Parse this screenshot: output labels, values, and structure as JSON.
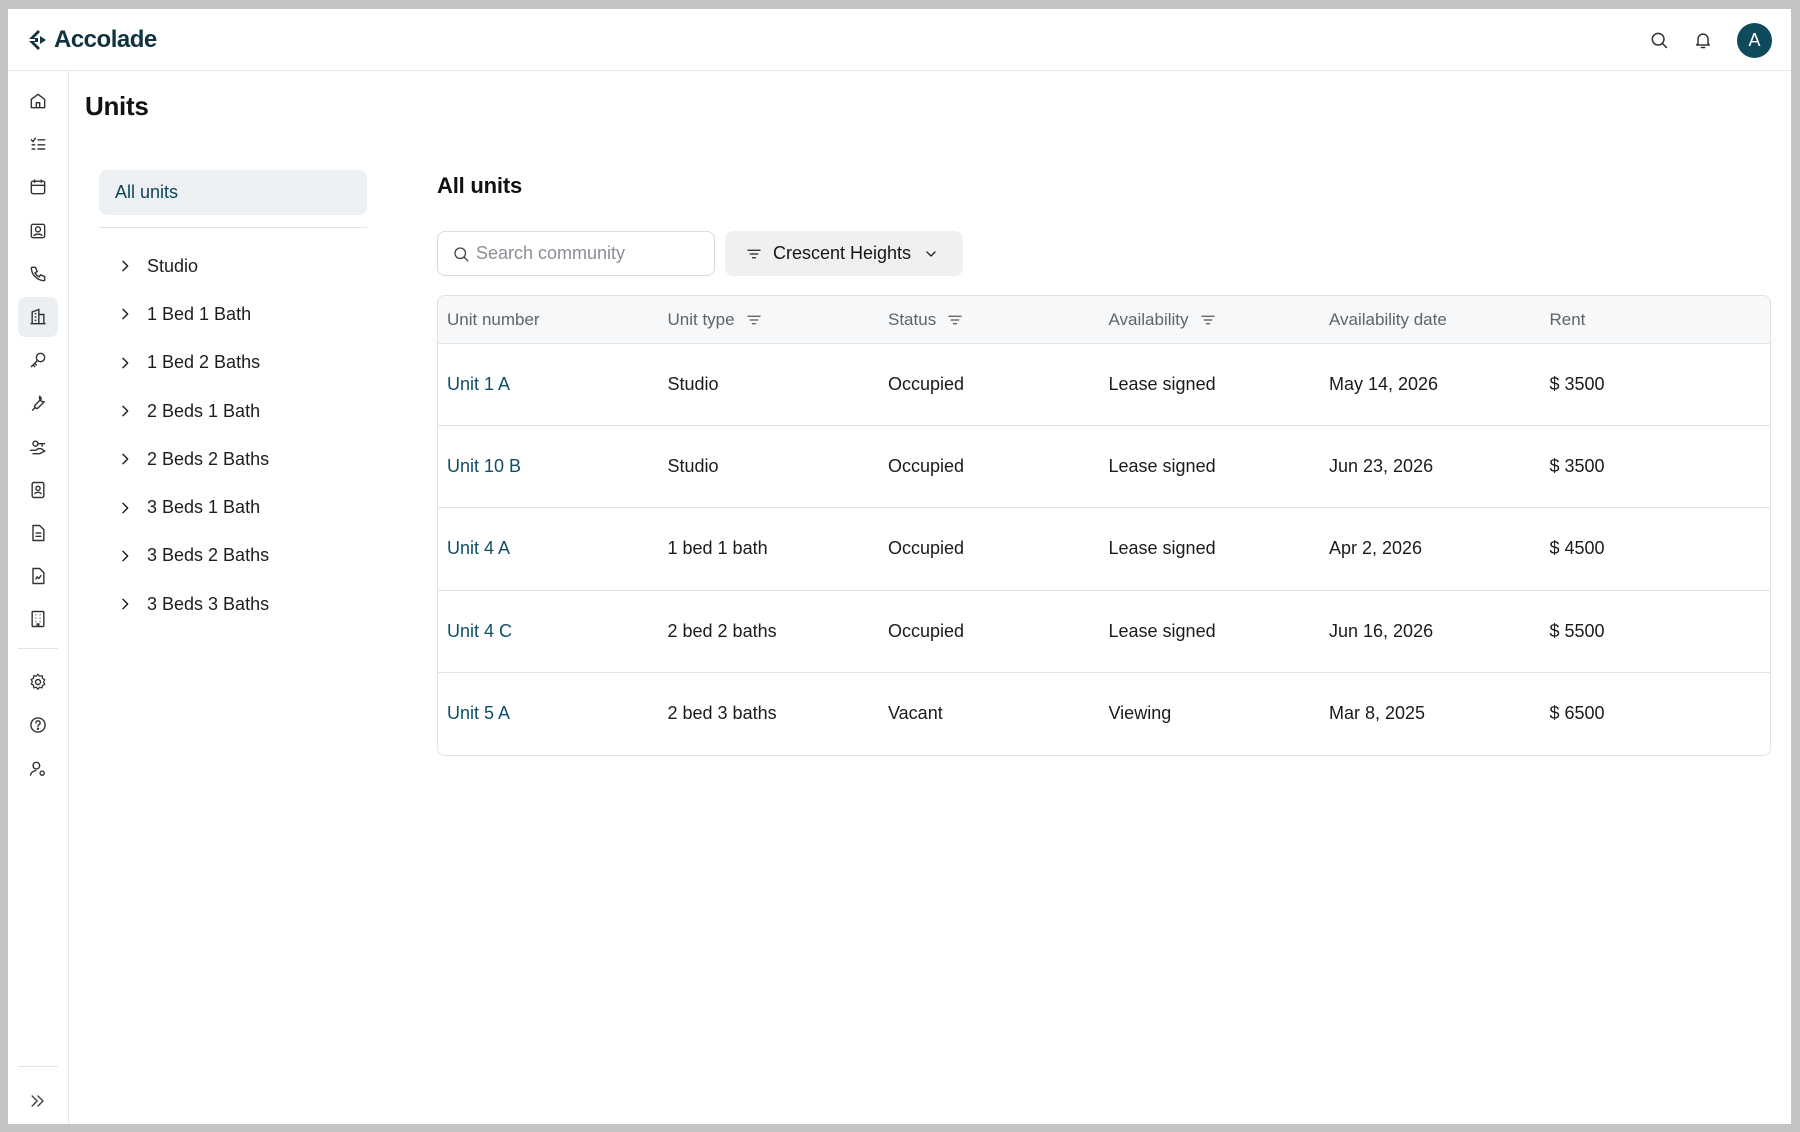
{
  "app": {
    "brand": "Accolade",
    "avatar_initial": "A",
    "accent": "#0e4a5c"
  },
  "header": {
    "icons": [
      "search-icon",
      "bell-icon"
    ]
  },
  "rail": {
    "items": [
      "home-icon",
      "tasks-icon",
      "calendar-icon",
      "contacts-icon",
      "phone-icon",
      "building-icon",
      "key-icon",
      "wrench-icon",
      "hand-key-icon",
      "profile-card-icon",
      "document-icon",
      "report-icon",
      "apartment-icon"
    ],
    "bottom_items": [
      "settings-icon",
      "help-icon",
      "user-settings-icon"
    ],
    "expand_icon": "expand-icon",
    "active": "building-icon"
  },
  "page": {
    "title": "Units"
  },
  "tree": {
    "all_label": "All units",
    "items": [
      {
        "label": "Studio"
      },
      {
        "label": "1 Bed 1 Bath"
      },
      {
        "label": "1 Bed 2 Baths"
      },
      {
        "label": "2 Beds 1 Bath"
      },
      {
        "label": "2 Beds 2 Baths"
      },
      {
        "label": "3 Beds 1 Bath"
      },
      {
        "label": "3 Beds 2 Baths"
      },
      {
        "label": "3 Beds 3 Baths"
      }
    ]
  },
  "content": {
    "title": "All units",
    "search_placeholder": "Search community",
    "filter_label": "Crescent Heights"
  },
  "table": {
    "columns": [
      {
        "label": "Unit number"
      },
      {
        "label": "Unit type"
      },
      {
        "label": "Status"
      },
      {
        "label": "Availability"
      },
      {
        "label": "Availability date"
      },
      {
        "label": "Rent"
      }
    ],
    "rows": [
      {
        "unit": "Unit 1 A",
        "type": "Studio",
        "status": "Occupied",
        "availability": "Lease signed",
        "date": "May 14, 2026",
        "rent": "$ 3500"
      },
      {
        "unit": "Unit 10 B",
        "type": "Studio",
        "status": "Occupied",
        "availability": "Lease signed",
        "date": "Jun 23, 2026",
        "rent": "$ 3500"
      },
      {
        "unit": "Unit 4 A",
        "type": "1 bed 1 bath",
        "status": "Occupied",
        "availability": "Lease signed",
        "date": "Apr 2, 2026",
        "rent": "$ 4500"
      },
      {
        "unit": "Unit 4 C",
        "type": "2 bed 2 baths",
        "status": "Occupied",
        "availability": "Lease signed",
        "date": "Jun 16, 2026",
        "rent": "$ 5500"
      },
      {
        "unit": "Unit 5 A",
        "type": "2 bed 3 baths",
        "status": "Vacant",
        "availability": "Viewing",
        "date": "Mar 8, 2025",
        "rent": "$ 6500"
      }
    ]
  }
}
